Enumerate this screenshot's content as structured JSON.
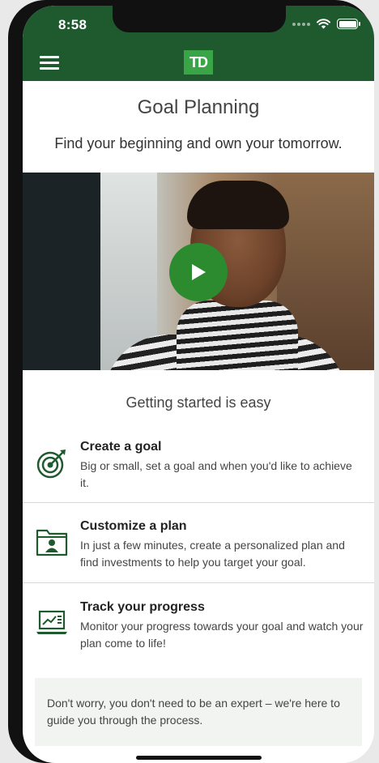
{
  "status_bar": {
    "time": "8:58"
  },
  "header": {
    "logo_text": "TD",
    "brand_color": "#1f5a2f",
    "logo_color": "#3aa546"
  },
  "page": {
    "title": "Goal Planning",
    "subtitle": "Find your beginning and own your tomorrow."
  },
  "video": {
    "play_button_color": "#2c8a2f"
  },
  "getting_started": {
    "heading": "Getting started is easy",
    "steps": [
      {
        "icon": "target-icon",
        "title": "Create a goal",
        "description": "Big or small, set a goal and when you'd like to achieve it."
      },
      {
        "icon": "folder-user-icon",
        "title": "Customize a plan",
        "description": "In just a few minutes, create a personalized plan and find investments to help you target your goal."
      },
      {
        "icon": "laptop-chart-icon",
        "title": "Track your progress",
        "description": "Monitor your progress towards your goal and watch your plan come to life!"
      }
    ]
  },
  "note": {
    "text": "Don't worry, you don't need to be an expert – we're here to guide you through the process."
  }
}
